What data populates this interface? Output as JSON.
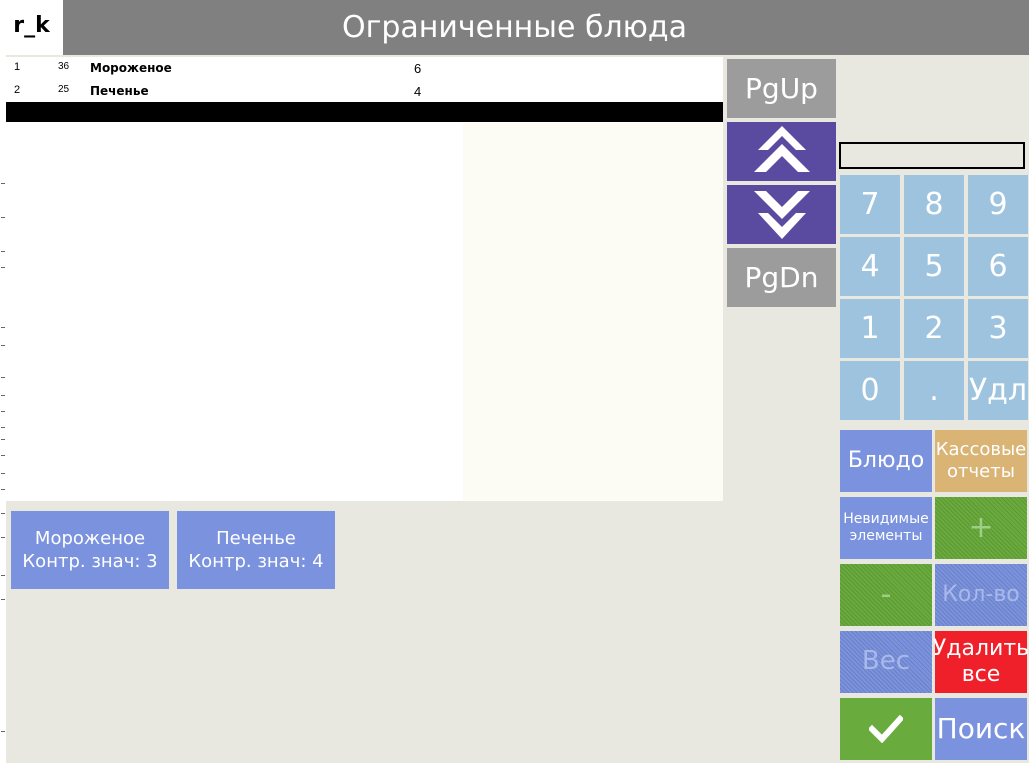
{
  "header": {
    "title": "Ограниченные блюда",
    "user": "r_k"
  },
  "order": {
    "rows": [
      {
        "num": "1",
        "code": "36",
        "name": "Мороженое",
        "qty": "6"
      },
      {
        "num": "2",
        "code": "25",
        "name": "Печенье",
        "qty": "4"
      }
    ]
  },
  "nav": {
    "pgup": "PgUp",
    "pgdn": "PgDn"
  },
  "numpad": {
    "k7": "7",
    "k8": "8",
    "k9": "9",
    "k4": "4",
    "k5": "5",
    "k6": "6",
    "k1": "1",
    "k2": "2",
    "k3": "3",
    "k0": "0",
    "kdot": ".",
    "kdel": "Удл"
  },
  "functions": {
    "dish": "Блюдо",
    "reports_line1": "Кассовые",
    "reports_line2": "отчеты",
    "hidden_line1": "Невидимые",
    "hidden_line2": "элементы",
    "plus": "+",
    "minus": "-",
    "qty": "Кол-во",
    "weight": "Вес",
    "delete_line1": "Удалить",
    "delete_line2": "все",
    "search": "Поиск"
  },
  "restrictions": [
    {
      "name": "Мороженое",
      "limit": "Контр. знач: 3"
    },
    {
      "name": "Печенье",
      "limit": "Контр. знач: 4"
    }
  ],
  "colors": {
    "header": "#808080",
    "accent_blue": "#7b93de",
    "numpad": "#9dc3df",
    "arrow": "#5a4aa0",
    "green": "#6aab3d",
    "red": "#f0202a",
    "gold": "#d9b475"
  },
  "icons": {
    "up": "double-chevron-up-icon",
    "down": "double-chevron-down-icon",
    "ok": "checkmark-icon"
  }
}
